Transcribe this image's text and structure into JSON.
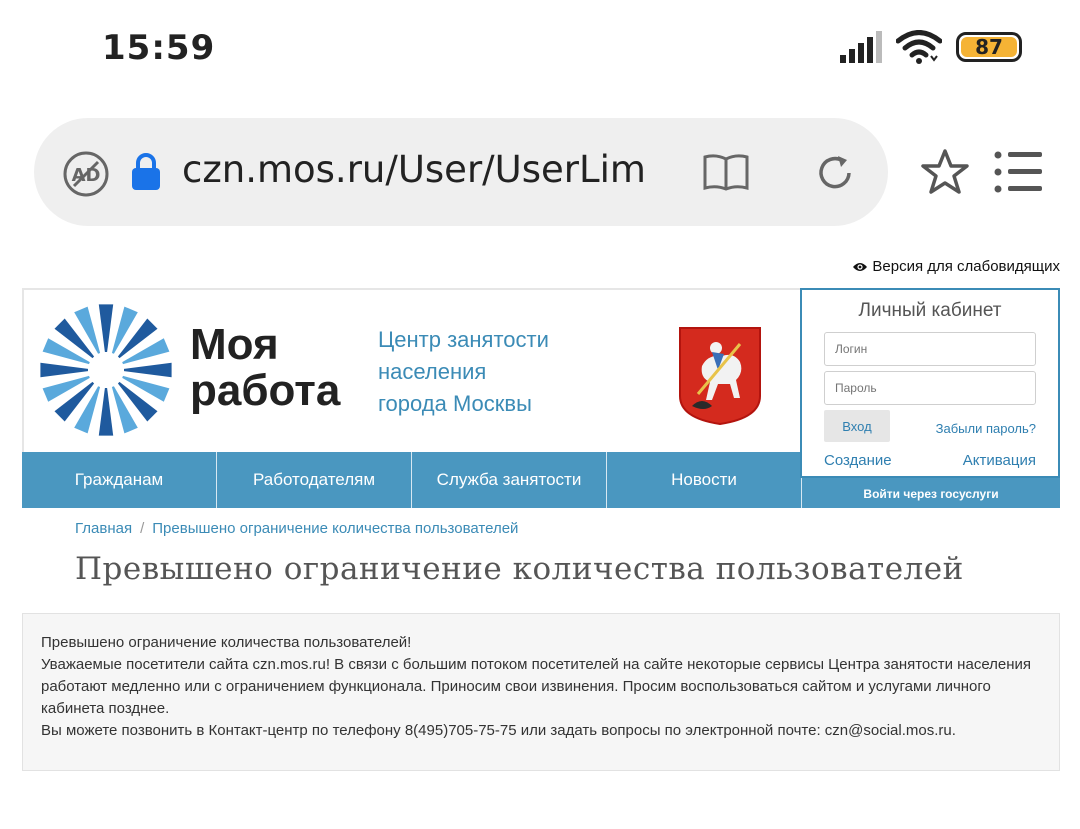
{
  "status_bar": {
    "time": "15:59",
    "battery": "87"
  },
  "browser": {
    "url": "czn.mos.ru/User/UserLimit",
    "icons": [
      "adblock-icon",
      "lock-icon",
      "reader-mode-icon",
      "reload-icon",
      "star-icon",
      "menu-icon"
    ]
  },
  "site": {
    "accessibility_link": "Версия для слабовидящих",
    "logo": {
      "line1": "Моя",
      "line2": "работа"
    },
    "center_name": {
      "line1": "Центр занятости",
      "line2": "населения",
      "line3": "города Москвы"
    },
    "cabinet": {
      "title": "Личный кабинет",
      "login_placeholder": "Логин",
      "password_placeholder": "Пароль",
      "login_button": "Вход",
      "forgot": "Забыли пароль?",
      "create": "Создание",
      "activate": "Активация",
      "gosuslugi": "Войти через госуслуги"
    },
    "nav": [
      {
        "label": "Гражданам"
      },
      {
        "label": "Работодателям"
      },
      {
        "label": "Служба занятости"
      },
      {
        "label": "Новости"
      }
    ],
    "breadcrumb": {
      "home": "Главная",
      "current": "Превышено ограничение количества пользователей"
    },
    "page_title": "Превышено ограничение количества пользователей",
    "notice": {
      "line1": "Превышено ограничение количества пользователей!",
      "line2": "Уважаемые посетители сайта czn.mos.ru! В связи с большим потоком посетителей на сайте некоторые сервисы Центра занятости населения работают медленно или с ограничением функционала. Приносим свои извинения. Просим воспользоваться сайтом и услугами личного кабинета позднее.",
      "line3": "Вы можете позвонить в Контакт-центр по телефону 8(495)705-75-75 или задать вопросы по электронной почте: czn@social.mos.ru."
    },
    "colors": {
      "accent": "#4a97c0",
      "link": "#3b8bb6",
      "logo_dark": "#1f5a9e",
      "logo_light": "#5aa9dc"
    }
  }
}
